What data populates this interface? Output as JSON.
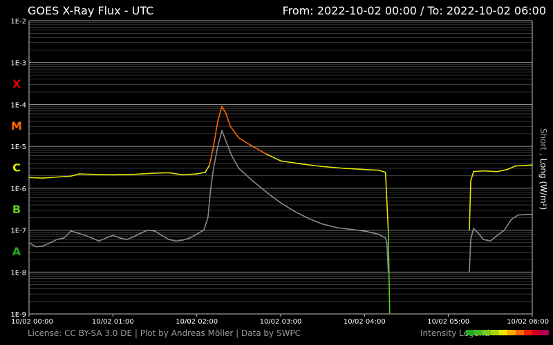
{
  "header": {
    "title": "GOES X-Ray Flux - UTC",
    "range": "From: 2022-10-02 00:00  /  To: 2022-10-02 06:00"
  },
  "footer": {
    "credits": "License: CC BY-SA 3.0 DE | Plot by Andreas Möller | Data by SWPC",
    "legend_label": "Intensity Legend"
  },
  "colors": {
    "background": "#000000",
    "grid": "#7a7a7a",
    "short_series": "#8a8a8a",
    "A": "#22aa22",
    "B": "#66cc22",
    "C": "#e6e600",
    "M": "#ff6600",
    "X": "#dd0000"
  },
  "legend_colors": [
    "#22aa22",
    "#44bb22",
    "#77cc22",
    "#aad411",
    "#e6e600",
    "#ffaa00",
    "#ff6600",
    "#ee2200",
    "#cc0022",
    "#aa0055"
  ],
  "chart_data": {
    "type": "line",
    "x_scale": "time",
    "y_scale": "log",
    "xlim": [
      "2022-10-02 00:00",
      "2022-10-02 06:00"
    ],
    "ylim": [
      1e-09,
      0.01
    ],
    "y_ticks": [
      "1E-2",
      "1E-3",
      "1E-4",
      "1E-5",
      "1E-6",
      "1E-7",
      "1E-8",
      "1E-9"
    ],
    "x_ticks": [
      "10/02 00:00",
      "10/02 01:00",
      "10/02 02:00",
      "10/02 03:00",
      "10/02 04:00",
      "10/02 05:00",
      "10/02 06:00"
    ],
    "flare_classes": [
      {
        "label": "X",
        "level": 0.0001
      },
      {
        "label": "M",
        "level": 1e-05
      },
      {
        "label": "C",
        "level": 1e-06
      },
      {
        "label": "B",
        "level": 1e-07
      },
      {
        "label": "A",
        "level": 1e-08
      }
    ],
    "ylabel_short": "Short",
    "ylabel_sep": " ,  ",
    "ylabel_long": "Long (W/m²)",
    "grid": true,
    "series": [
      {
        "name": "Long",
        "segments": [
          [
            [
              "00:00",
              1.8e-06
            ],
            [
              "00:10",
              1.75e-06
            ],
            [
              "00:20",
              1.85e-06
            ],
            [
              "00:30",
              1.95e-06
            ],
            [
              "00:36",
              2.2e-06
            ],
            [
              "00:45",
              2.15e-06
            ],
            [
              "01:00",
              2.1e-06
            ],
            [
              "01:15",
              2.15e-06
            ],
            [
              "01:30",
              2.3e-06
            ],
            [
              "01:40",
              2.35e-06
            ],
            [
              "01:50",
              2.1e-06
            ],
            [
              "02:00",
              2.2e-06
            ],
            [
              "02:06",
              2.4e-06
            ],
            [
              "02:09",
              3.5e-06
            ],
            [
              "02:12",
              1e-05
            ],
            [
              "02:15",
              4e-05
            ],
            [
              "02:18",
              9e-05
            ],
            [
              "02:21",
              6e-05
            ],
            [
              "02:24",
              3e-05
            ],
            [
              "02:30",
              1.6e-05
            ],
            [
              "02:40",
              1e-05
            ],
            [
              "02:50",
              6.5e-06
            ],
            [
              "03:00",
              4.5e-06
            ],
            [
              "03:15",
              3.8e-06
            ],
            [
              "03:30",
              3.3e-06
            ],
            [
              "03:45",
              3e-06
            ],
            [
              "04:00",
              2.8e-06
            ],
            [
              "04:10",
              2.7e-06
            ],
            [
              "04:15",
              2.4e-06
            ],
            [
              "04:17",
              1e-07
            ],
            [
              "04:18",
              1e-09
            ]
          ],
          [
            [
              "05:15",
              1e-07
            ],
            [
              "05:16",
              1.5e-06
            ],
            [
              "05:18",
              2.5e-06
            ],
            [
              "05:25",
              2.6e-06
            ],
            [
              "05:35",
              2.5e-06
            ],
            [
              "05:42",
              2.8e-06
            ],
            [
              "05:48",
              3.4e-06
            ],
            [
              "05:55",
              3.5e-06
            ],
            [
              "06:00",
              3.6e-06
            ]
          ]
        ]
      },
      {
        "name": "Short",
        "segments": [
          [
            [
              "00:00",
              5e-08
            ],
            [
              "00:05",
              4e-08
            ],
            [
              "00:10",
              4.2e-08
            ],
            [
              "00:15",
              5e-08
            ],
            [
              "00:20",
              6e-08
            ],
            [
              "00:25",
              6.5e-08
            ],
            [
              "00:30",
              9.5e-08
            ],
            [
              "00:35",
              8.5e-08
            ],
            [
              "00:40",
              7.5e-08
            ],
            [
              "00:45",
              6.5e-08
            ],
            [
              "00:50",
              5.5e-08
            ],
            [
              "00:55",
              6.5e-08
            ],
            [
              "01:00",
              7.5e-08
            ],
            [
              "01:05",
              6.5e-08
            ],
            [
              "01:10",
              6e-08
            ],
            [
              "01:15",
              7e-08
            ],
            [
              "01:20",
              8.5e-08
            ],
            [
              "01:25",
              1e-07
            ],
            [
              "01:30",
              9.5e-08
            ],
            [
              "01:35",
              7.5e-08
            ],
            [
              "01:40",
              6e-08
            ],
            [
              "01:45",
              5.5e-08
            ],
            [
              "01:50",
              5.8e-08
            ],
            [
              "01:55",
              6.5e-08
            ],
            [
              "02:00",
              8e-08
            ],
            [
              "02:05",
              1e-07
            ],
            [
              "02:08",
              2e-07
            ],
            [
              "02:10",
              1e-06
            ],
            [
              "02:12",
              3e-06
            ],
            [
              "02:15",
              1e-05
            ],
            [
              "02:18",
              2.4e-05
            ],
            [
              "02:21",
              1.3e-05
            ],
            [
              "02:25",
              6e-06
            ],
            [
              "02:30",
              3e-06
            ],
            [
              "02:40",
              1.5e-06
            ],
            [
              "02:50",
              8e-07
            ],
            [
              "03:00",
              4.5e-07
            ],
            [
              "03:10",
              2.8e-07
            ],
            [
              "03:20",
              1.9e-07
            ],
            [
              "03:30",
              1.4e-07
            ],
            [
              "03:40",
              1.15e-07
            ],
            [
              "03:50",
              1.05e-07
            ],
            [
              "04:00",
              9.5e-08
            ],
            [
              "04:10",
              8e-08
            ],
            [
              "04:15",
              6.5e-08
            ],
            [
              "04:16",
              5e-08
            ],
            [
              "04:17",
              1e-08
            ]
          ],
          [
            [
              "05:15",
              1e-08
            ],
            [
              "05:16",
              6e-08
            ],
            [
              "05:18",
              1.1e-07
            ],
            [
              "05:22",
              8e-08
            ],
            [
              "05:25",
              6e-08
            ],
            [
              "05:30",
              5.5e-08
            ],
            [
              "05:35",
              7.5e-08
            ],
            [
              "05:40",
              1e-07
            ],
            [
              "05:45",
              1.8e-07
            ],
            [
              "05:50",
              2.3e-07
            ],
            [
              "06:00",
              2.4e-07
            ]
          ]
        ]
      }
    ]
  }
}
